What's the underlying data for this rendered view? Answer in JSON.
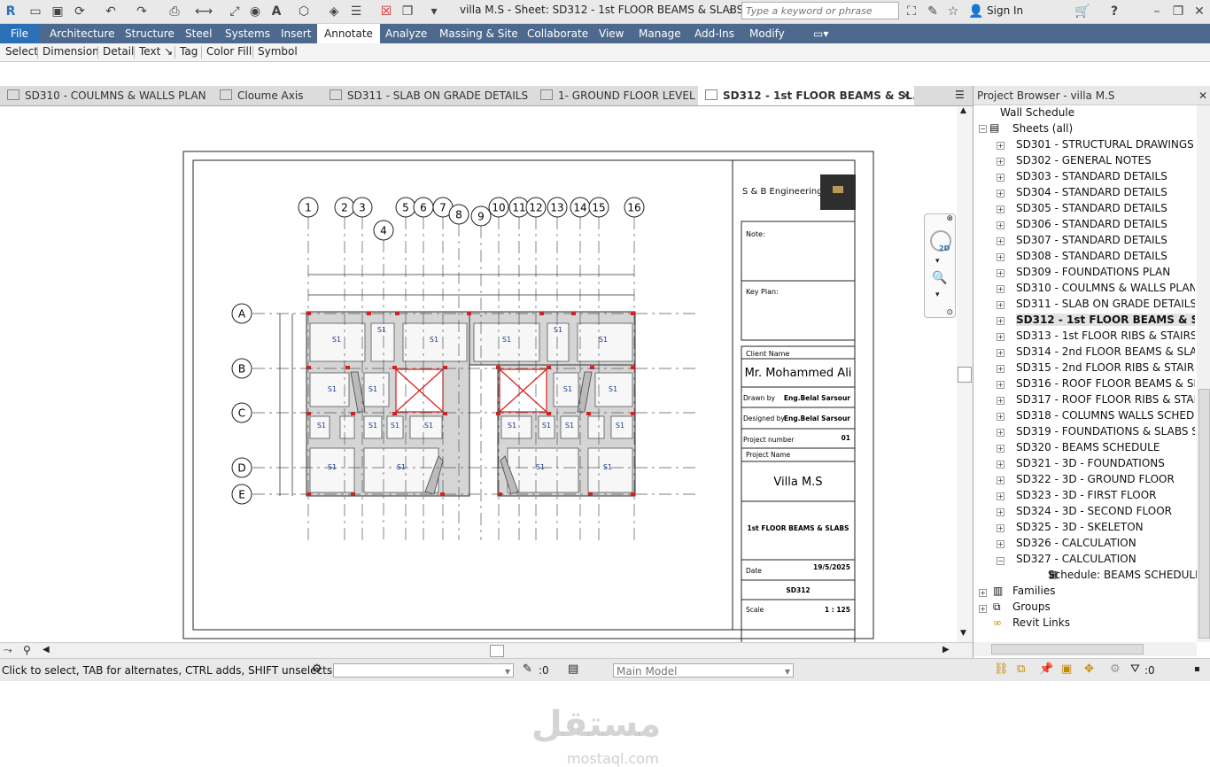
{
  "window": {
    "title": "villa M.S - Sheet: SD312 - 1st FLOOR BEAMS & SLABS",
    "search_placeholder": "Type a keyword or phrase",
    "sign_in": "Sign In"
  },
  "menu": {
    "file": "File",
    "items": [
      "Architecture",
      "Structure",
      "Steel",
      "Systems",
      "Insert",
      "Annotate",
      "Analyze",
      "Massing & Site",
      "Collaborate",
      "View",
      "Manage",
      "Add-Ins",
      "Modify"
    ],
    "active": "Annotate"
  },
  "ribbon": {
    "items": [
      "Select",
      "Dimension",
      "Detail",
      "Text ↘",
      "Tag",
      "Color Fill",
      "Symbol"
    ]
  },
  "tabs": [
    {
      "label": "SD310 - COULMNS & WALLS PLAN"
    },
    {
      "label": "Cloume Axis"
    },
    {
      "label": "SD311 - SLAB ON GRADE DETAILS"
    },
    {
      "label": "1- GROUND FLOOR LEVEL"
    },
    {
      "label": "SD312 - 1st FLOOR BEAMS & SL..."
    }
  ],
  "browser": {
    "title": "Project Browser - villa M.S",
    "wall_schedule": "Wall Schedule",
    "sheets_root": "Sheets (all)",
    "sheets": [
      "SD301 - STRUCTURAL DRAWINGS LIST",
      "SD302 - GENERAL NOTES",
      "SD303 - STANDARD DETAILS",
      "SD304 - STANDARD DETAILS",
      "SD305 - STANDARD DETAILS",
      "SD306 - STANDARD DETAILS",
      "SD307 - STANDARD DETAILS",
      "SD308 - STANDARD DETAILS",
      "SD309 - FOUNDATIONS PLAN",
      "SD310 - COULMNS & WALLS PLAN",
      "SD311 - SLAB ON GRADE DETAILS",
      "SD312 - 1st FLOOR BEAMS & SLABS",
      "SD313 - 1st FLOOR RIBS & STAIRS DET",
      "SD314 - 2nd FLOOR BEAMS & SLABS",
      "SD315 - 2nd FLOOR RIBS & STAIRS DE",
      "SD316 - ROOF FLOOR BEAMS & SLABS",
      "SD317 - ROOF FLOOR RIBS & STAIRS D",
      "SD318 - COLUMNS WALLS SCHEDULE",
      "SD319 - FOUNDATIONS & SLABS SCHE",
      "SD320 - BEAMS SCHEDULE",
      "SD321 - 3D - FOUNDATIONS",
      "SD322 - 3D - GROUND FLOOR",
      "SD323 - 3D - FIRST FLOOR",
      "SD324 - 3D - SECOND FLOOR",
      "SD325 - 3D - SKELETON",
      "SD326 - CALCULATION",
      "SD327 - CALCULATION"
    ],
    "active_sheet": "SD312 - 1st FLOOR BEAMS & SLABS",
    "schedule_child": "Schedule: BEAMS SCHEDULE",
    "families": "Families",
    "groups": "Groups",
    "revit_links": "Revit Links"
  },
  "sheet": {
    "company": "S & B Engineering",
    "note_label": "Note:",
    "keyplan_label": "Key Plan:",
    "client_label": "Client Name",
    "client": "Mr. Mohammed Ali",
    "drawn_label": "Drawn by",
    "drawn_by": "Eng.Belal Sarsour",
    "designed_label": "Designed by",
    "designed_by": "Eng.Belal Sarsour",
    "projnum_label": "Project number",
    "projnum": "01",
    "projname_label": "Project Name",
    "projname": "Villa M.S",
    "sheet_title": "1st FLOOR BEAMS & SLABS",
    "date_label": "Date",
    "date": "19/5/2025",
    "sheet_number": "SD312",
    "scale_label": "Scale",
    "scale": "1 : 125",
    "grid_numbers": [
      "1",
      "2",
      "3",
      "4",
      "5",
      "6",
      "7",
      "8",
      "9",
      "10",
      "11",
      "12",
      "13",
      "14",
      "15",
      "16"
    ],
    "grid_letters": [
      "A",
      "B",
      "C",
      "D",
      "E"
    ],
    "slab_label": "S1"
  },
  "status": {
    "hint": "Click to select, TAB for alternates, CTRL adds, SHIFT unselects.",
    "zero": ":0",
    "model": "Main Model"
  },
  "watermark": {
    "main": "مستقل",
    "sub": "mostaql.com"
  },
  "colors": {
    "menubar": "#4d6a8e",
    "file": "#2b6fb6",
    "accent_red": "#e01b1b"
  }
}
